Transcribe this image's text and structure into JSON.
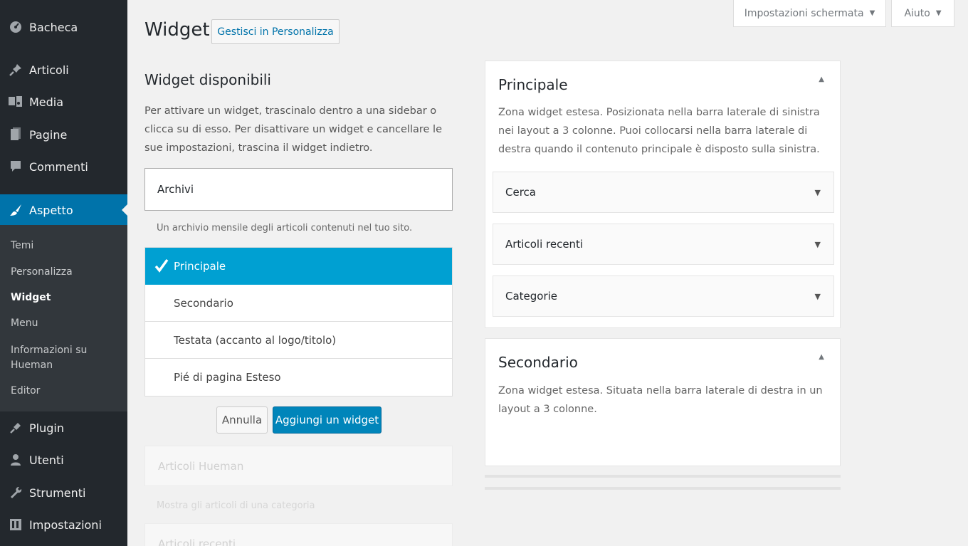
{
  "sidebar": {
    "top_items": [
      {
        "label": "Bacheca",
        "icon": "dashboard-icon"
      },
      {
        "label": "Articoli",
        "icon": "pin-icon"
      },
      {
        "label": "Media",
        "icon": "media-icon"
      },
      {
        "label": "Pagine",
        "icon": "page-icon"
      },
      {
        "label": "Commenti",
        "icon": "comment-icon"
      },
      {
        "label": "Aspetto",
        "icon": "brush-icon"
      }
    ],
    "submenu": [
      "Temi",
      "Personalizza",
      "Widget",
      "Menu",
      "Informazioni su Hueman",
      "Editor"
    ],
    "bottom_items": [
      {
        "label": "Plugin",
        "icon": "plugin-icon"
      },
      {
        "label": "Utenti",
        "icon": "user-icon"
      },
      {
        "label": "Strumenti",
        "icon": "wrench-icon"
      },
      {
        "label": "Impostazioni",
        "icon": "settings-icon"
      }
    ]
  },
  "header": {
    "screen_options": "Impostazioni schermata",
    "help": "Aiuto",
    "title": "Widget",
    "customize_button": "Gestisci in Personalizza"
  },
  "available": {
    "title": "Widget disponibili",
    "description": "Per attivare un widget, trascinalo dentro a una sidebar o clicca su di esso. Per disattivare un widget e cancellare le sue impostazioni, trascina il widget indietro.",
    "expanded_widget": {
      "name": "Archivi",
      "description": "Un archivio mensile degli articoli contenuti nel tuo sito."
    },
    "chooser": [
      "Principale",
      "Secondario",
      "Testata (accanto al logo/titolo)",
      "Pié di pagina Esteso"
    ],
    "cancel_label": "Annulla",
    "add_label": "Aggiungi un widget",
    "faded_widgets": [
      {
        "name": "Articoli Hueman",
        "description": "Mostra gli articoli di una categoria"
      },
      {
        "name": "Articoli recenti"
      }
    ]
  },
  "areas": [
    {
      "title": "Principale",
      "description": "Zona widget estesa. Posizionata nella barra laterale di sinistra nei layout a 3 colonne. Puoi collocarsi nella barra laterale di destra quando il contenuto principale è disposto sulla sinistra.",
      "widgets": [
        "Cerca",
        "Articoli recenti",
        "Categorie"
      ]
    },
    {
      "title": "Secondario",
      "description": "Zona widget estesa. Situata nella barra laterale di destra in un layout a 3 colonne."
    }
  ],
  "colors": {
    "sidebar_bg": "#23282d",
    "submenu_bg": "#32373c",
    "accent": "#0073aa",
    "selected": "#00a0d2",
    "primary_button": "#0085ba"
  }
}
